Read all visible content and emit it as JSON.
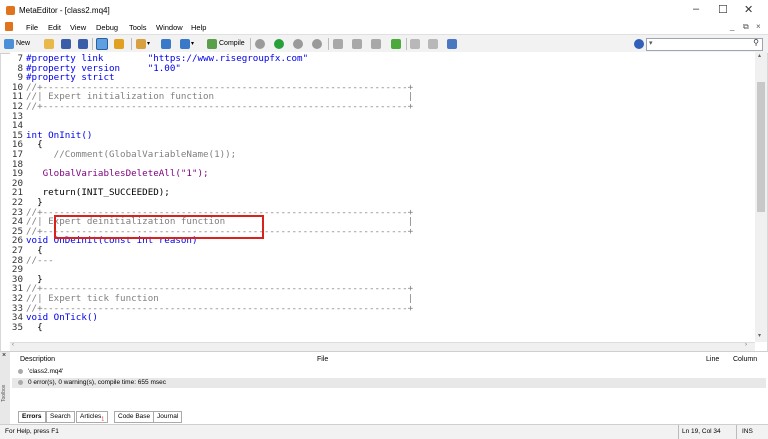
{
  "window": {
    "title": "MetaEditor - [class2.mq4]",
    "controls": {
      "minimize": "–",
      "maximize": "☐",
      "close": "✕"
    },
    "mdi_controls": {
      "minimize": "_",
      "restore": "⧉",
      "close": "×"
    }
  },
  "menu": [
    "File",
    "Edit",
    "View",
    "Debug",
    "Tools",
    "Window",
    "Help"
  ],
  "toolbar": {
    "new_label": "New",
    "compile_label": "Compile"
  },
  "editor": {
    "lines": [
      {
        "n": "7",
        "text": "#property link        \"https://www.risegroupfx.com\""
      },
      {
        "n": "8",
        "text": "#property version     \"1.00\""
      },
      {
        "n": "9",
        "text": "#property strict"
      },
      {
        "n": "10",
        "text": "//+------------------------------------------------------------------+"
      },
      {
        "n": "11",
        "text": "//| Expert initialization function                                   |"
      },
      {
        "n": "12",
        "text": "//+------------------------------------------------------------------+"
      },
      {
        "n": "13",
        "text": ""
      },
      {
        "n": "14",
        "text": ""
      },
      {
        "n": "15",
        "text": "int OnInit()"
      },
      {
        "n": "16",
        "text": "  {"
      },
      {
        "n": "17",
        "text": "     //Comment(GlobalVariableName(1));"
      },
      {
        "n": "18",
        "text": ""
      },
      {
        "n": "19",
        "text": "   GlobalVariablesDeleteAll(\"1\");"
      },
      {
        "n": "20",
        "text": ""
      },
      {
        "n": "21",
        "text": "   return(INIT_SUCCEEDED);"
      },
      {
        "n": "22",
        "text": "  }"
      },
      {
        "n": "23",
        "text": "//+------------------------------------------------------------------+"
      },
      {
        "n": "24",
        "text": "//| Expert deinitialization function                                 |"
      },
      {
        "n": "25",
        "text": "//+------------------------------------------------------------------+"
      },
      {
        "n": "26",
        "text": "void OnDeinit(const int reason)"
      },
      {
        "n": "27",
        "text": "  {"
      },
      {
        "n": "28",
        "text": "//---"
      },
      {
        "n": "29",
        "text": ""
      },
      {
        "n": "30",
        "text": "  }"
      },
      {
        "n": "31",
        "text": "//+------------------------------------------------------------------+"
      },
      {
        "n": "32",
        "text": "//| Expert tick function                                             |"
      },
      {
        "n": "33",
        "text": "//+------------------------------------------------------------------+"
      },
      {
        "n": "34",
        "text": "void OnTick()"
      },
      {
        "n": "35",
        "text": "  {"
      }
    ]
  },
  "toolbox": {
    "headers": {
      "description": "Description",
      "file": "File",
      "line": "Line",
      "column": "Column"
    },
    "rows": [
      {
        "description": "'class2.mq4'"
      },
      {
        "description": "0 error(s), 0 warning(s), compile time: 655 msec"
      }
    ],
    "side_label": "Toolbox",
    "tabs": [
      "Errors",
      "Search",
      "Articles",
      "Code Base",
      "Journal"
    ],
    "articles_badge": "1"
  },
  "status": {
    "help": "For Help, press F1",
    "position": "Ln 19, Col 34",
    "mode": "INS"
  },
  "colors": {
    "keyword": "#0000ee",
    "string": "#7f007f",
    "comment": "#808080",
    "highlight_box": "#d9221c"
  }
}
